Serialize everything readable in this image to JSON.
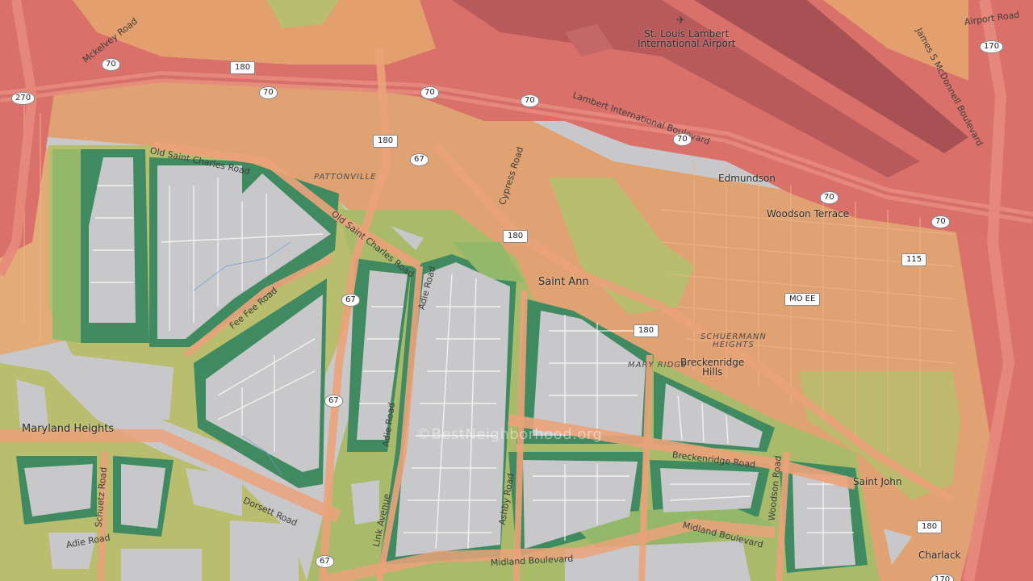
{
  "map": {
    "watermark": "©BestNeighborhood.org",
    "airport_icon": "airplane-icon",
    "places": [
      {
        "id": "st-louis-airport",
        "text": "St. Louis Lambert\nInternational Airport"
      },
      {
        "id": "edmundson",
        "text": "Edmundson"
      },
      {
        "id": "woodson-terrace",
        "text": "Woodson Terrace"
      },
      {
        "id": "saint-ann",
        "text": "Saint Ann"
      },
      {
        "id": "breckenridge-hills",
        "text": "Breckenridge\nHills"
      },
      {
        "id": "maryland-heights",
        "text": "Maryland Heights"
      },
      {
        "id": "saint-john",
        "text": "Saint John"
      },
      {
        "id": "charlack",
        "text": "Charlack"
      }
    ],
    "neighborhoods": [
      {
        "id": "pattonville",
        "text": "PATTONVILLE"
      },
      {
        "id": "schuermann-heights",
        "text": "SCHUERMANN\nHEIGHTS"
      },
      {
        "id": "mary-ridge",
        "text": "MARY RIDGE"
      }
    ],
    "roads": [
      {
        "id": "mckelvey-road",
        "text": "Mckelvey Road"
      },
      {
        "id": "airport-road",
        "text": "Airport Road"
      },
      {
        "id": "james-s-mcdonnell-blvd",
        "text": "James S McDonnell Boulevard"
      },
      {
        "id": "lambert-intl-blvd",
        "text": "Lambert International Boulevard"
      },
      {
        "id": "old-saint-charles-road-1",
        "text": "Old Saint Charles Road"
      },
      {
        "id": "old-saint-charles-road-2",
        "text": "Old Saint Charles Road"
      },
      {
        "id": "cypress-road",
        "text": "Cypress Road"
      },
      {
        "id": "fee-fee-road",
        "text": "Fee Fee Road"
      },
      {
        "id": "adie-road-1",
        "text": "Adie Road"
      },
      {
        "id": "adie-road-2",
        "text": "Adie Road"
      },
      {
        "id": "adie-road-3",
        "text": "Adie Road"
      },
      {
        "id": "link-avenue",
        "text": "Link Avenue"
      },
      {
        "id": "ashby-road",
        "text": "Ashby Road"
      },
      {
        "id": "schuetz-road",
        "text": "Schuetz Road"
      },
      {
        "id": "dorsett-road",
        "text": "Dorsett Road"
      },
      {
        "id": "breckenridge-road",
        "text": "Breckenridge Road"
      },
      {
        "id": "woodson-road",
        "text": "Woodson Road"
      },
      {
        "id": "midland-boulevard-1",
        "text": "Midland Boulevard"
      },
      {
        "id": "midland-boulevard-2",
        "text": "Midland Boulevard"
      }
    ],
    "shields": [
      {
        "id": "i70-a",
        "text": "70"
      },
      {
        "id": "i70-b",
        "text": "70"
      },
      {
        "id": "i70-c",
        "text": "70"
      },
      {
        "id": "i70-d",
        "text": "70"
      },
      {
        "id": "i70-e",
        "text": "70"
      },
      {
        "id": "i70-f",
        "text": "70"
      },
      {
        "id": "i70-g",
        "text": "70"
      },
      {
        "id": "i270",
        "text": "270"
      },
      {
        "id": "i170-a",
        "text": "170"
      },
      {
        "id": "i170-b",
        "text": "170"
      },
      {
        "id": "rt180-a",
        "text": "180"
      },
      {
        "id": "rt180-b",
        "text": "180"
      },
      {
        "id": "rt180-c",
        "text": "180"
      },
      {
        "id": "rt180-d",
        "text": "180"
      },
      {
        "id": "rt180-e",
        "text": "180"
      },
      {
        "id": "rt67-a",
        "text": "67"
      },
      {
        "id": "rt67-b",
        "text": "67"
      },
      {
        "id": "rt67-c",
        "text": "67"
      },
      {
        "id": "rt67-d",
        "text": "67"
      },
      {
        "id": "rt115",
        "text": "115"
      },
      {
        "id": "mo-ee",
        "text": "MO EE"
      }
    ],
    "zone_colors": {
      "red": "#d9706a",
      "dark_red": "#b85a5c",
      "orange": "#e3a06e",
      "yellow_green": "#b9bd6e",
      "light_green": "#93b86a",
      "dark_green": "#3f8a60",
      "gray": "#c8c8ca"
    }
  }
}
